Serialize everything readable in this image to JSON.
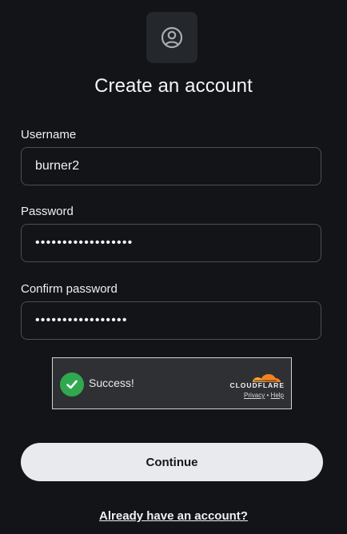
{
  "header": {
    "avatar_icon": "user-circle-icon",
    "title": "Create an account"
  },
  "form": {
    "username": {
      "label": "Username",
      "value": "burner2"
    },
    "password": {
      "label": "Password",
      "masked_value": "••••••••••••••••••"
    },
    "confirm_password": {
      "label": "Confirm password",
      "masked_value": "•••••••••••••••••"
    }
  },
  "captcha": {
    "status_icon": "check-icon",
    "status_text": "Success!",
    "brand": "CLOUDFLARE",
    "privacy_label": "Privacy",
    "separator": "•",
    "help_label": "Help",
    "colors": {
      "success": "#2fa84f",
      "brand_orange": "#f48120"
    }
  },
  "actions": {
    "continue_label": "Continue",
    "login_link": "Already have an account?"
  }
}
